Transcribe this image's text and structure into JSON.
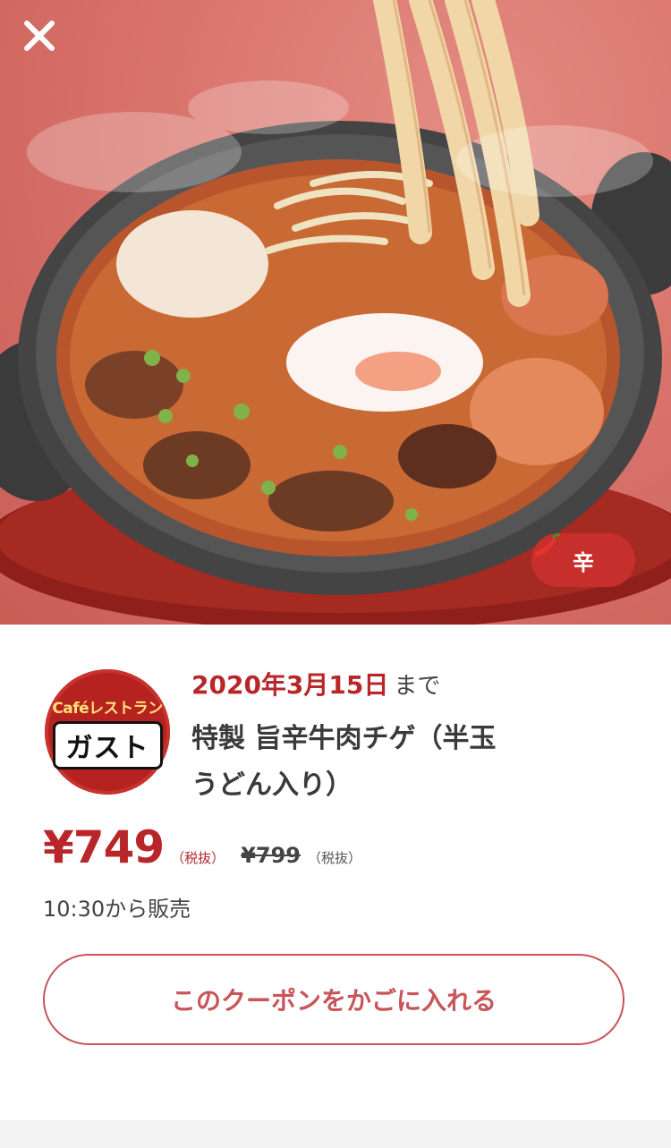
{
  "header": {
    "close_icon": "close-icon"
  },
  "hero": {
    "spicy_badge": {
      "icon": "chili-pepper-icon",
      "label": "辛"
    }
  },
  "store": {
    "logo_top": "Caféレストラン",
    "logo_main": "ガスト"
  },
  "coupon": {
    "expiry_date": "2020年3月15日",
    "expiry_suffix": "まで",
    "product_line1": "特製 旨辛牛肉チゲ（半玉",
    "product_line2": "うどん入り）",
    "price": "¥749",
    "tax_label": "（税抜）",
    "original_price": "¥799",
    "original_tax_label": "（税抜）",
    "sale_time": "10:30から販売"
  },
  "actions": {
    "add_to_cart_label": "このクーポンをかごに入れる"
  },
  "colors": {
    "accent": "#b8262a",
    "button_border": "#c8555a",
    "hero_bg": "#d9746c"
  }
}
